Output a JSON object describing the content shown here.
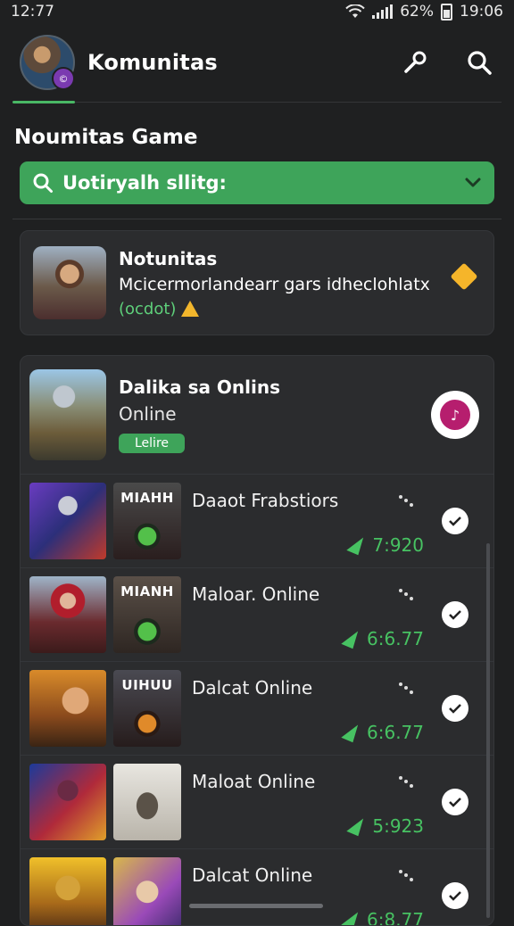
{
  "status_bar": {
    "time": "12:77",
    "battery": "62%",
    "clock": "19:06"
  },
  "header": {
    "title": "Komunitas",
    "key_icon": "key-icon",
    "search_icon": "search-icon"
  },
  "section": {
    "title": "Noumitas Game"
  },
  "search": {
    "value": "Uotiryalh sllitg:",
    "icon": "search-icon",
    "chevron": "chevron-down-icon"
  },
  "notification": {
    "title": "Notunitas",
    "subtitle": "Mcicermorlandearr gars idheclohlatx",
    "tag": "(ocdot)"
  },
  "featured": {
    "title": "Dalika sa Onlins",
    "subtitle": "Online",
    "badge": "Lelire"
  },
  "games": [
    {
      "label": "MIAHH",
      "title": "Daaot Frabstiors",
      "score": "7:920"
    },
    {
      "label": "MIANH",
      "title": "Maloar. Online",
      "score": "6:6.77"
    },
    {
      "label": "UIHUU",
      "title": "Dalcat Online",
      "score": "6:6.77"
    },
    {
      "label": "",
      "title": "Maloat Online",
      "score": "5:923"
    },
    {
      "label": "",
      "title": "Dalcat Online",
      "score": "6:8.77"
    }
  ],
  "colors": {
    "accent": "#3ea45a",
    "score": "#47c262",
    "background": "#1f2021",
    "card": "#2b2c2e"
  }
}
